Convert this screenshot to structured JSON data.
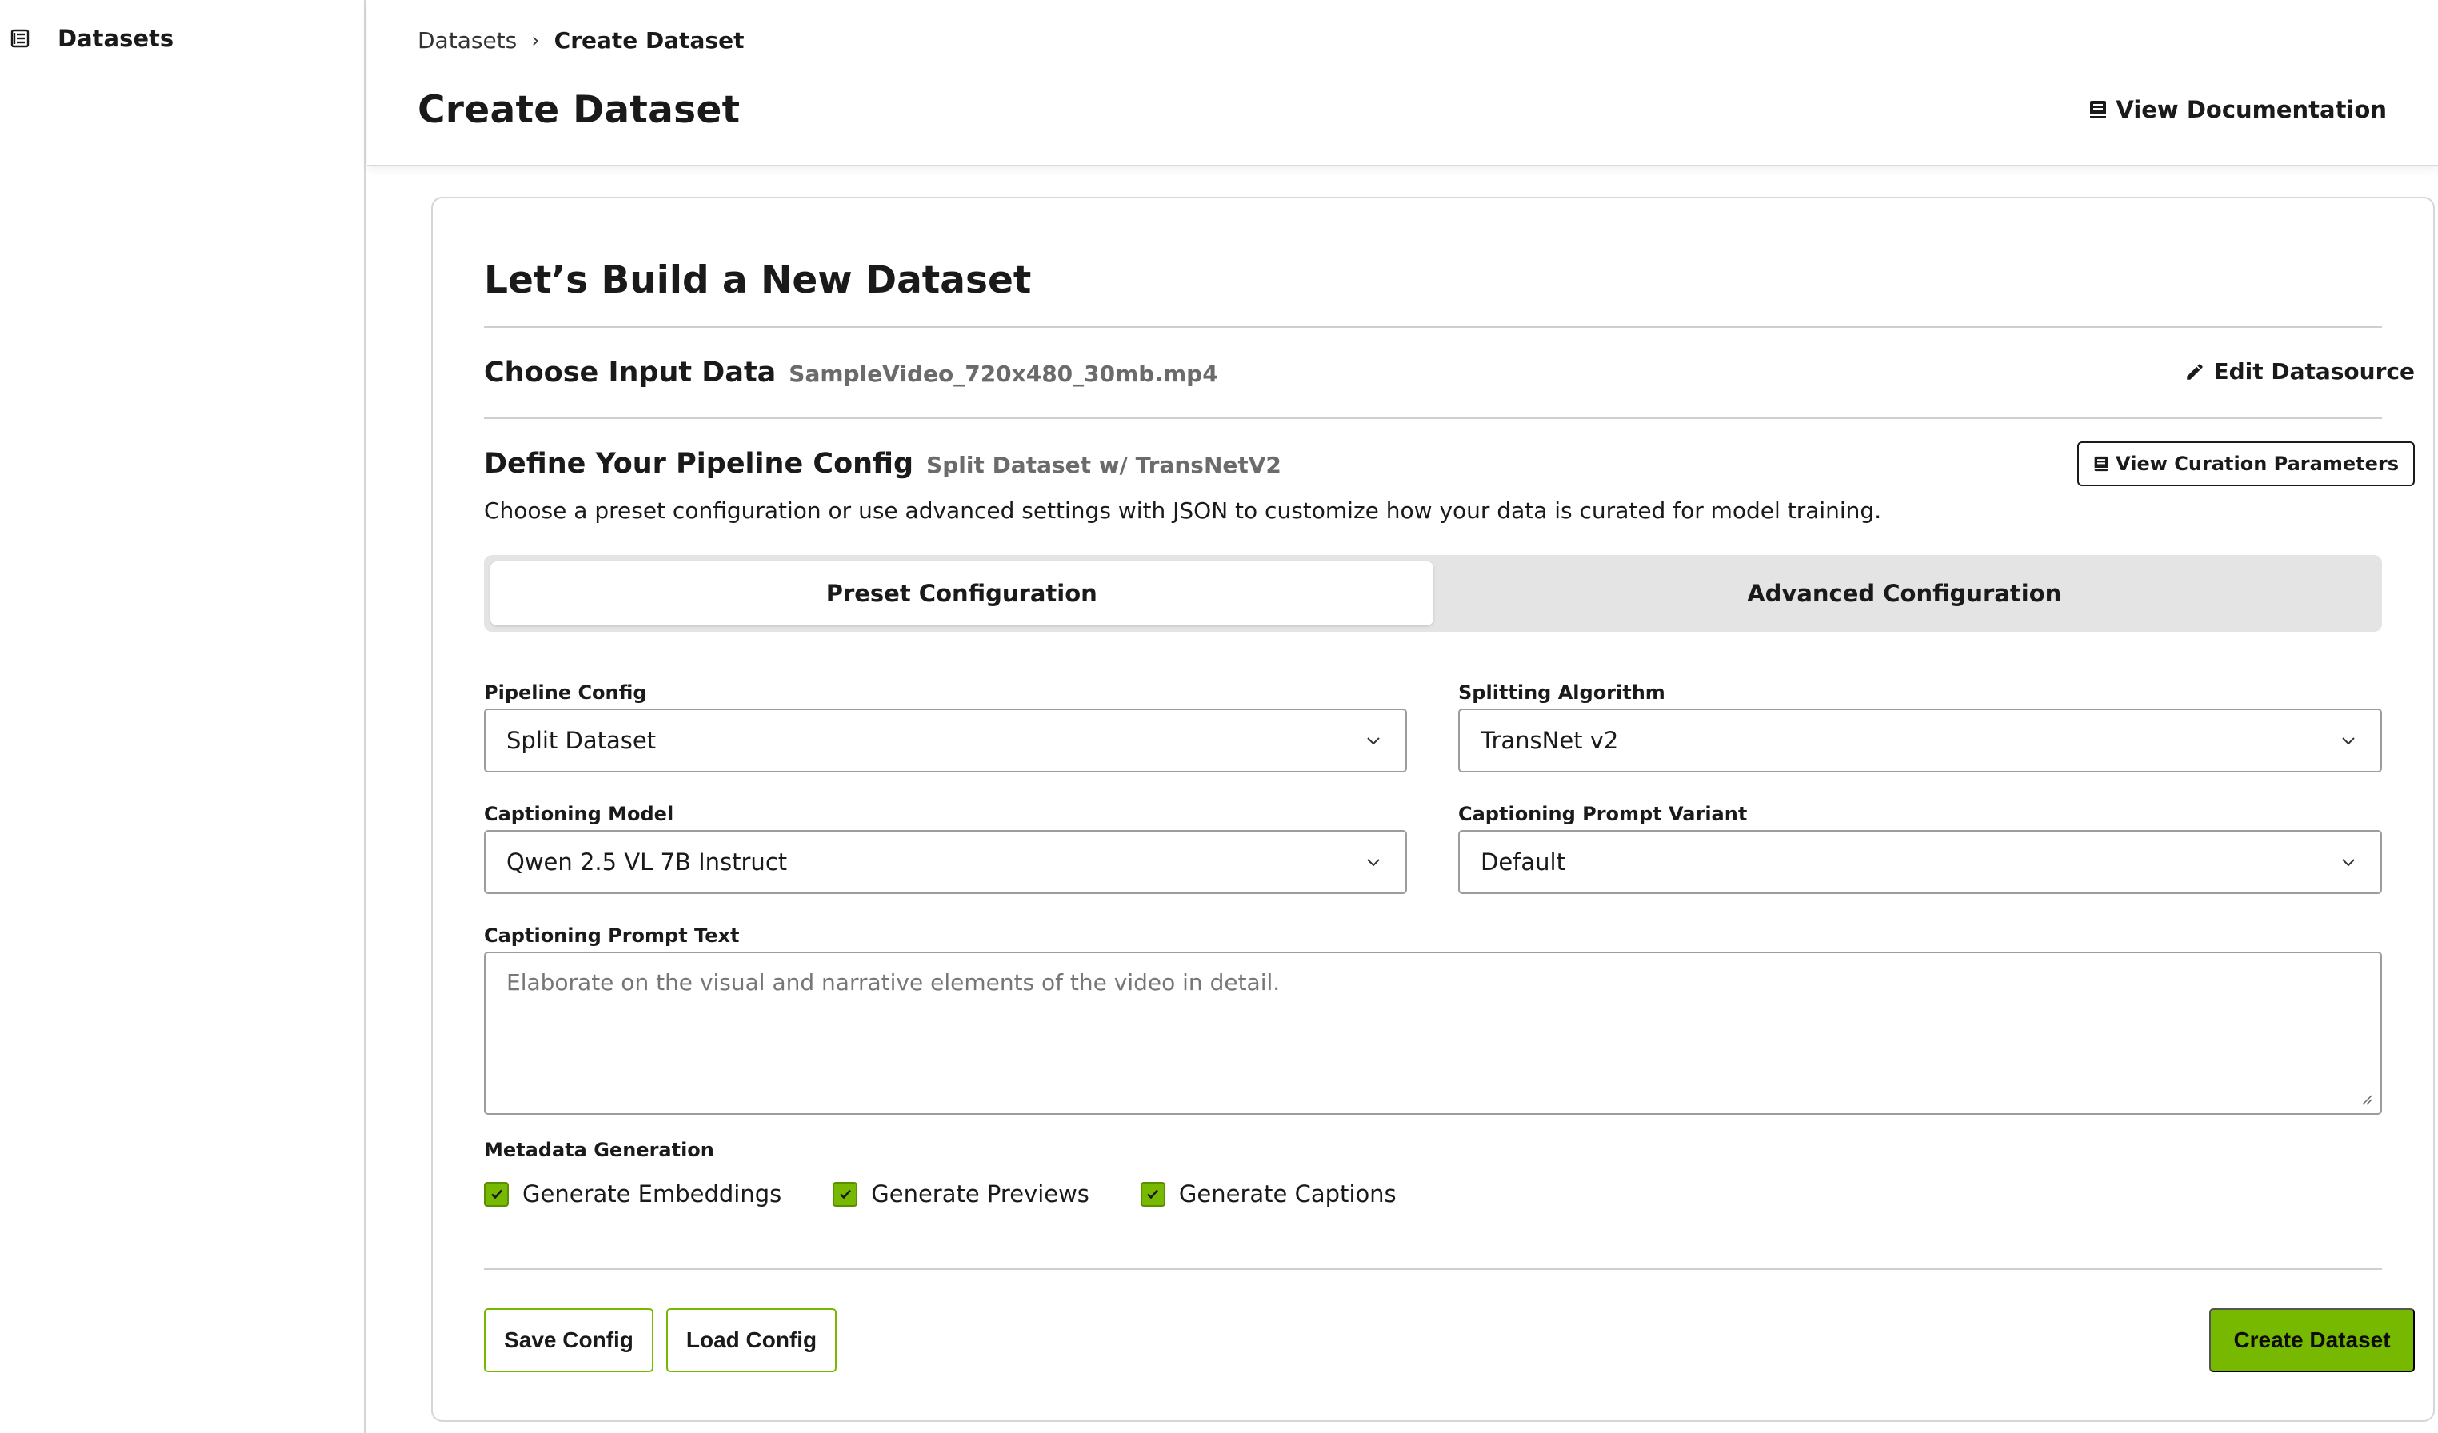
{
  "sidebar": {
    "items": [
      {
        "label": "Datasets",
        "icon": "dataset-list-icon"
      }
    ]
  },
  "header": {
    "breadcrumb": {
      "parent": "Datasets",
      "separator": "›",
      "current": "Create Dataset"
    },
    "title": "Create Dataset",
    "doc_link": "View Documentation"
  },
  "card": {
    "title": "Let’s Build a New Dataset",
    "input_data": {
      "title": "Choose Input Data",
      "file_name": "SampleVideo_720x480_30mb.mp4",
      "edit_label": "Edit Datasource"
    },
    "pipeline": {
      "title": "Define Your Pipeline Config",
      "subtitle": "Split Dataset w/ TransNetV2",
      "curation_button": "View Curation Parameters",
      "description": "Choose a preset configuration or use advanced settings with JSON to customize how your data is curated for model training."
    },
    "tabs": [
      {
        "label": "Preset Configuration",
        "active": true
      },
      {
        "label": "Advanced Configuration",
        "active": false
      }
    ],
    "fields": {
      "pipeline_config": {
        "label": "Pipeline Config",
        "value": "Split Dataset"
      },
      "splitting_algorithm": {
        "label": "Splitting Algorithm",
        "value": "TransNet v2"
      },
      "captioning_model": {
        "label": "Captioning Model",
        "value": "Qwen 2.5 VL 7B Instruct"
      },
      "prompt_variant": {
        "label": "Captioning Prompt Variant",
        "value": "Default"
      },
      "prompt_text": {
        "label": "Captioning Prompt Text",
        "placeholder": "Elaborate on the visual and narrative elements of the video in detail."
      }
    },
    "metadata": {
      "label": "Metadata Generation",
      "options": [
        {
          "label": "Generate Embeddings",
          "checked": true
        },
        {
          "label": "Generate Previews",
          "checked": true
        },
        {
          "label": "Generate Captions",
          "checked": true
        }
      ]
    },
    "actions": {
      "save": "Save Config",
      "load": "Load Config",
      "create": "Create Dataset"
    }
  },
  "colors": {
    "accent": "#76b900",
    "border": "#9c9c9c",
    "tab_bg": "#e4e4e4",
    "muted_text": "#6b6b6b"
  }
}
